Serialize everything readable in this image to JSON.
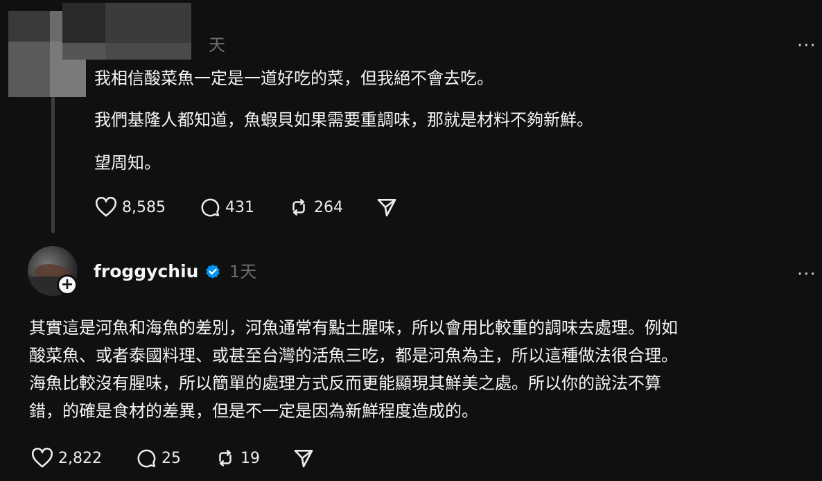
{
  "post1": {
    "time_label": "天",
    "paragraphs": [
      "我相信酸菜魚一定是一道好吃的菜，但我絕不會去吃。",
      "我們基隆人都知道，魚蝦貝如果需要重調味，那就是材料不夠新鮮。",
      "望周知。"
    ],
    "more_label": "···",
    "likes": "8,585",
    "comments": "431",
    "reposts": "264"
  },
  "post2": {
    "username": "froggychiu",
    "time_label": "1天",
    "more_label": "···",
    "follow_badge": "+",
    "lines": [
      "其實這是河魚和海魚的差別，河魚通常有點土腥味，所以會用比較重的調味去處理。例如",
      "酸菜魚、或者泰國料理、或甚至台灣的活魚三吃，都是河魚為主，所以這種做法很合理。",
      "海魚比較沒有腥味，所以簡單的處理方式反而更能顯現其鮮美之處。所以你的說法不算",
      "錯，的確是食材的差異，但是不一定是因為新鮮程度造成的。"
    ],
    "likes": "2,822",
    "comments": "25",
    "reposts": "19"
  },
  "colors": {
    "background": "#101010",
    "text": "#f3f5f7",
    "muted": "#6e6e6e",
    "verified": "#0095f6"
  },
  "icons": [
    "heart-icon",
    "comment-icon",
    "repost-icon",
    "share-icon",
    "verified-badge-icon",
    "more-icon",
    "plus-icon"
  ]
}
